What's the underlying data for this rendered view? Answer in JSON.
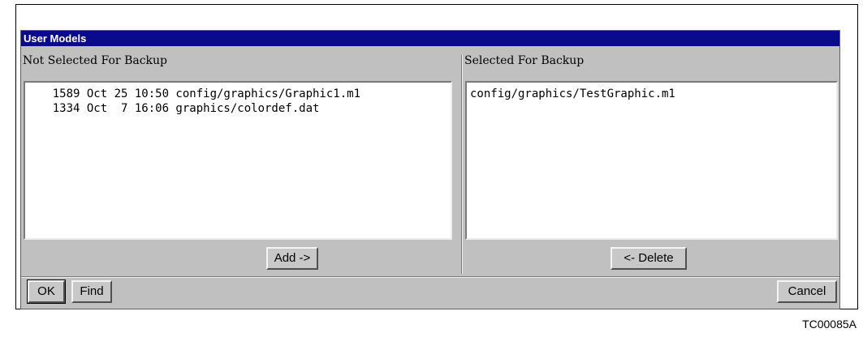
{
  "window": {
    "title": "User Models"
  },
  "left_pane": {
    "label": "Not Selected For Backup",
    "rows": [
      "    1589 Oct 25 10:50 config/graphics/Graphic1.m1",
      "    1334 Oct  7 16:06 graphics/colordef.dat"
    ],
    "button": "Add ->"
  },
  "right_pane": {
    "label": "Selected For Backup",
    "rows": [
      "config/graphics/TestGraphic.m1"
    ],
    "button": "<- Delete"
  },
  "footer": {
    "ok": "OK",
    "find": "Find",
    "cancel": "Cancel"
  },
  "figure_code": "TC00085A",
  "colors": {
    "titlebar": "#0a0a8c",
    "dialog": "#c0c0c0"
  }
}
